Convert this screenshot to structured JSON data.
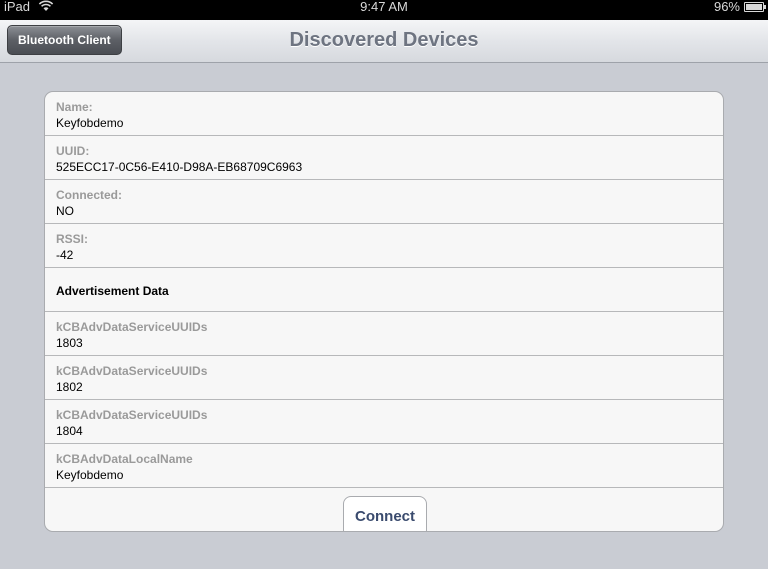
{
  "status_bar": {
    "carrier": "iPad",
    "time": "9:47 AM",
    "battery": "96%"
  },
  "nav": {
    "back_label": "Bluetooth Client",
    "title": "Discovered Devices"
  },
  "device": [
    {
      "label": "Name:",
      "value": "Keyfobdemo"
    },
    {
      "label": "UUID:",
      "value": "525ECC17-0C56-E410-D98A-EB68709C6963"
    },
    {
      "label": "Connected:",
      "value": "NO"
    },
    {
      "label": "RSSI:",
      "value": "-42"
    }
  ],
  "advertisement": {
    "header": "Advertisement Data",
    "items": [
      {
        "label": "kCBAdvDataServiceUUIDs",
        "value": "1803"
      },
      {
        "label": "kCBAdvDataServiceUUIDs",
        "value": "1802"
      },
      {
        "label": "kCBAdvDataServiceUUIDs",
        "value": "1804"
      },
      {
        "label": "kCBAdvDataLocalName",
        "value": "Keyfobdemo"
      }
    ]
  },
  "connect_label": "Connect"
}
